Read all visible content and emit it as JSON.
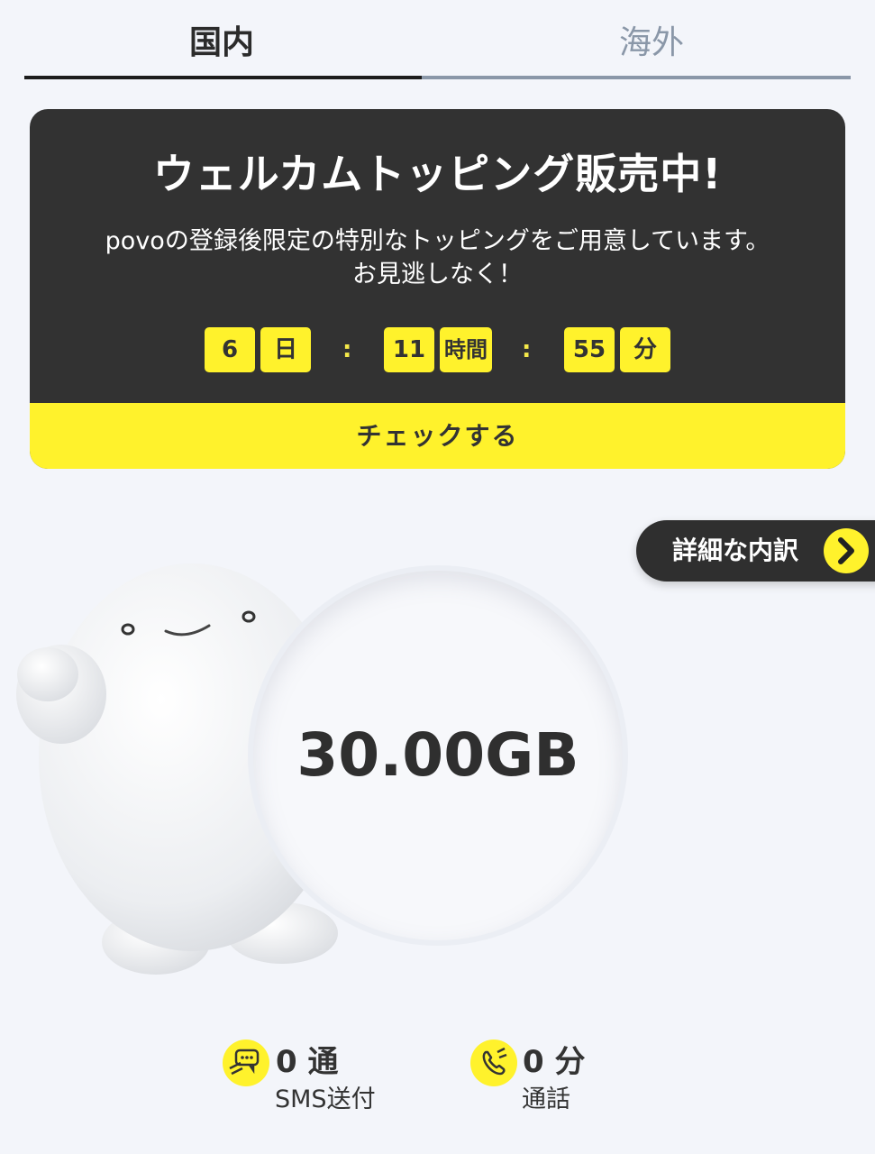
{
  "tabs": [
    {
      "label": "国内",
      "active": true
    },
    {
      "label": "海外",
      "active": false
    }
  ],
  "promo": {
    "title": "ウェルカムトッピング販売中!",
    "description_line1": "povoの登録後限定の特別なトッピングをご用意しています。",
    "description_line2": "お見逃しなく！",
    "countdown": {
      "days": "6",
      "days_unit": "日",
      "hours": "11",
      "hours_unit": "時間",
      "minutes": "55",
      "minutes_unit": "分",
      "separator": ":"
    },
    "cta_label": "チェックする"
  },
  "detail_button": {
    "label": "詳細な内訳",
    "icon": "chevron-right-icon"
  },
  "data_remaining": "30.00GB",
  "sms": {
    "value": "0 通",
    "label": "SMS送付",
    "icon": "sms-icon"
  },
  "call": {
    "value": "0 分",
    "label": "通話",
    "icon": "phone-icon"
  },
  "colors": {
    "accent": "#fff22c",
    "dark": "#323232",
    "background": "#f3f5fa",
    "inactive_tab": "#8a97a8"
  }
}
